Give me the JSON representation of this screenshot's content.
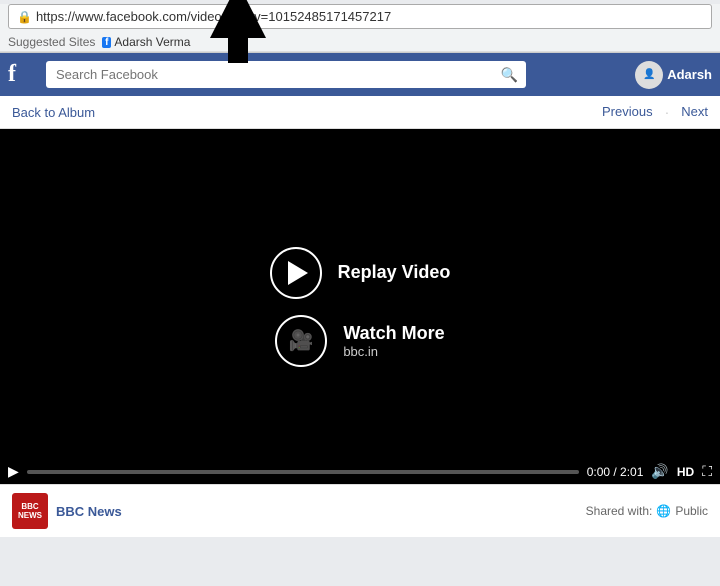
{
  "browser": {
    "url": "https://www.facebook.com/video.php?v=10152485171457217",
    "lock_symbol": "🔒",
    "bookmarks_label": "Suggested Sites",
    "bookmark_name": "Adarsh Verma",
    "fb_favicon": "f"
  },
  "navbar": {
    "logo": "f",
    "search_placeholder": "Search Facebook",
    "username": "Adarsh"
  },
  "album_nav": {
    "back_label": "Back to Album",
    "previous_label": "Previous",
    "next_label": "Next"
  },
  "video": {
    "replay_label": "Replay Video",
    "watch_more_label": "Watch More",
    "watch_more_sublabel": "bbc.in",
    "time_display": "0:00 / 2:01",
    "quality": "HD"
  },
  "post": {
    "source": "BBC News",
    "bbc_line1": "BBC",
    "bbc_line2": "NEWS",
    "shared_label": "Shared with:",
    "visibility": "Public"
  }
}
